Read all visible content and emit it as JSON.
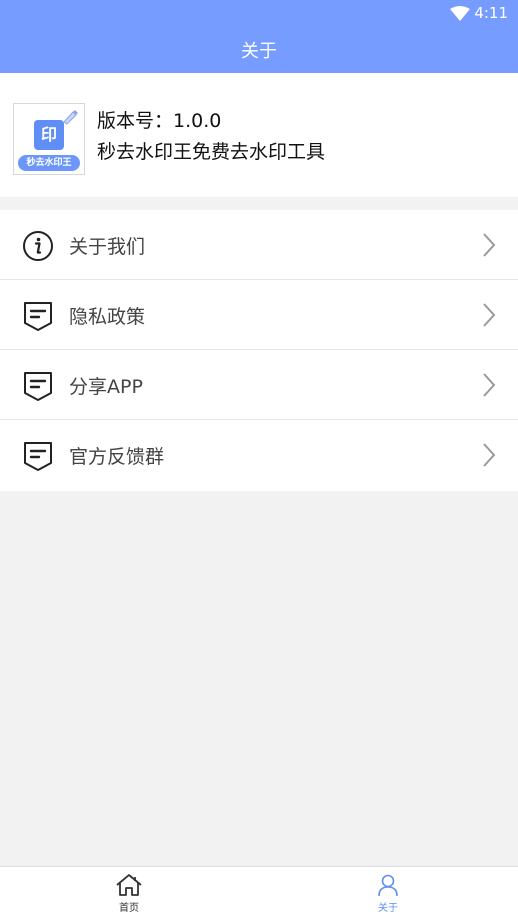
{
  "status_bar": {
    "time": "4:11",
    "wifi_icon": "wifi-icon"
  },
  "header": {
    "title": "关于",
    "background_color": "#779cff"
  },
  "app_info": {
    "logo": {
      "glyph": "印",
      "banner_text": "秒去水印王"
    },
    "version_text": "版本号：1.0.0",
    "slogan": "秒去水印王免费去水印工具"
  },
  "menu": {
    "items": [
      {
        "label": "关于我们",
        "icon": "info-icon"
      },
      {
        "label": "隐私政策",
        "icon": "message-icon"
      },
      {
        "label": "分享APP",
        "icon": "message-icon"
      },
      {
        "label": "官方反馈群",
        "icon": "message-icon"
      }
    ]
  },
  "bottom_nav": {
    "items": [
      {
        "label": "首页",
        "icon": "home-icon",
        "active": false
      },
      {
        "label": "关于",
        "icon": "user-icon",
        "active": true
      }
    ],
    "active_color": "#5f8ef7"
  }
}
